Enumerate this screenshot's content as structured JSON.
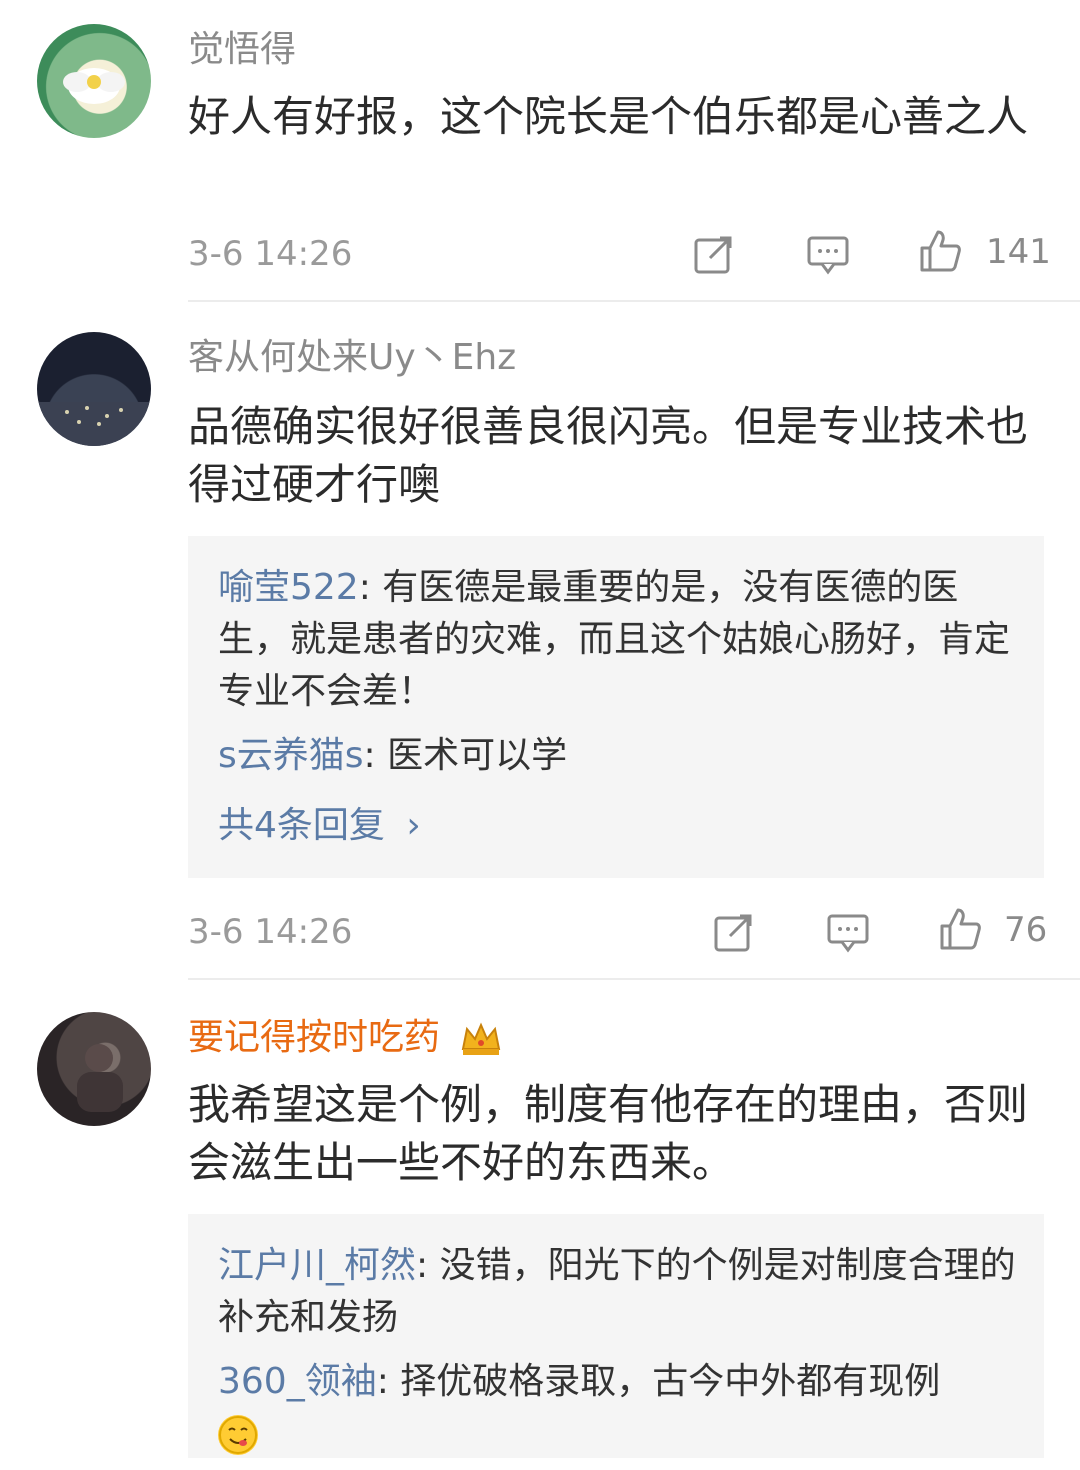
{
  "comments": [
    {
      "username": "觉悟得",
      "text": "好人有好报，这个院长是个伯乐都是心善之人",
      "time": "3-6 14:26",
      "likes": "141",
      "icons": [
        "share-icon",
        "comment-icon",
        "like-icon"
      ]
    },
    {
      "username": "客从何处来Uy丶Ehz",
      "text": "品德确实很好很善良很闪亮。但是专业技术也得过硬才行噢",
      "replies": [
        {
          "name": "喻莹522",
          "text": ": 有医德是最重要的是，没有医德的医生，就是患者的灾难，而且这个姑娘心肠好，肯定专业不会差！"
        },
        {
          "name": "s云养猫s",
          "text": ": 医术可以学"
        }
      ],
      "total_replies": "共4条回复",
      "time": "3-6 14:26",
      "likes": "76",
      "icons": [
        "share-icon",
        "comment-icon",
        "like-icon"
      ]
    },
    {
      "username": "要记得按时吃药",
      "badge": "crown-icon",
      "text": "我希望这是个例，制度有他存在的理由，否则会滋生出一些不好的东西来。",
      "replies": [
        {
          "name": "江户川_柯然",
          "text": ": 没错，阳光下的个例是对制度合理的补充和发扬"
        },
        {
          "name": "360_领袖",
          "text": ": 择优破格录取，古今中外都有现例"
        }
      ]
    }
  ],
  "colors": {
    "link": "#5b7ba6",
    "vip_name": "#e86a12",
    "meta": "#9a9a9a"
  }
}
